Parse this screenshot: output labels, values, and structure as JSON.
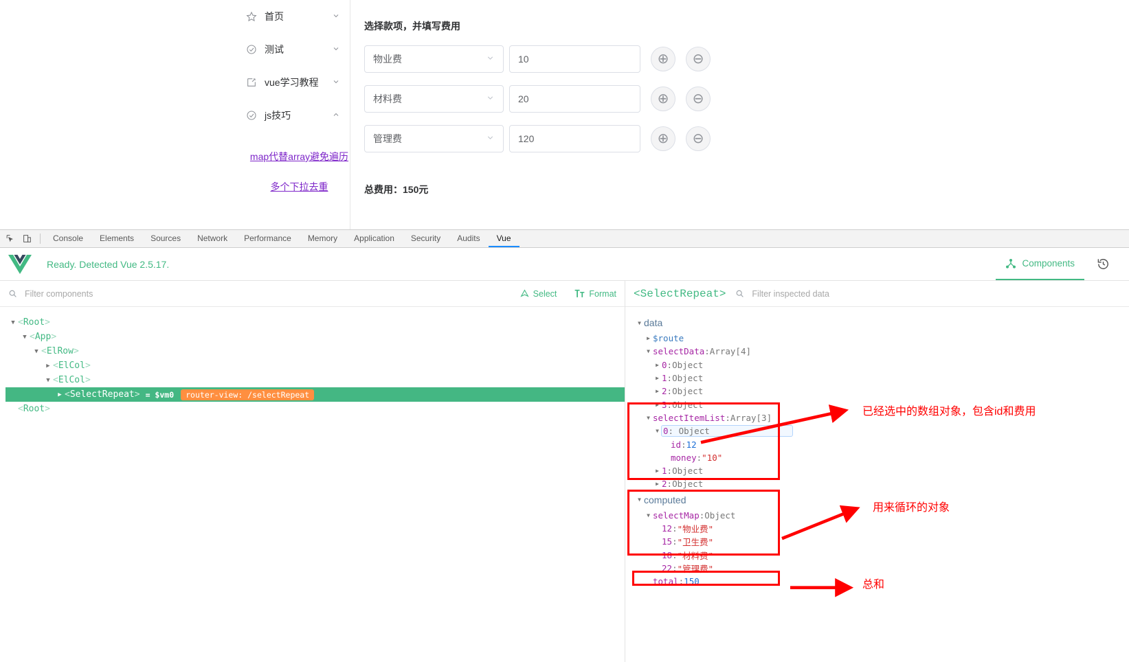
{
  "app": {
    "menu": [
      {
        "label": "首页",
        "icon": "star-icon",
        "arrow": "chevron-down-icon"
      },
      {
        "label": "测试",
        "icon": "check-circle-icon",
        "arrow": "chevron-down-icon"
      },
      {
        "label": "vue学习教程",
        "icon": "edit-square-icon",
        "arrow": "chevron-down-icon"
      },
      {
        "label": "js技巧",
        "icon": "check-circle-icon",
        "arrow": "chevron-up-icon"
      }
    ],
    "sub_links": [
      "map代替array避免遍历",
      "多个下拉去重"
    ],
    "main_title": "选择款项，并填写费用",
    "rows": [
      {
        "select": "物业费",
        "amount": "10",
        "add": "⊕",
        "remove": "⊖"
      },
      {
        "select": "材料费",
        "amount": "20",
        "add": "⊕",
        "remove": "⊖"
      },
      {
        "select": "管理费",
        "amount": "120",
        "add": "⊕",
        "remove": "⊖"
      }
    ],
    "total": "总费用：150元"
  },
  "devtools": {
    "tabs": [
      "Console",
      "Elements",
      "Sources",
      "Network",
      "Performance",
      "Memory",
      "Application",
      "Security",
      "Audits",
      "Vue"
    ],
    "active_tab": "Vue",
    "tool_icons": [
      "inspect-element-icon",
      "toggle-device-toolbar-icon"
    ],
    "accent": "#1a8cff"
  },
  "vue": {
    "ready_text": "Ready. Detected Vue 2.5.17.",
    "brand_color": "#42b983",
    "components_tab": "Components",
    "history_icon": "time-travel-icon",
    "logo_icon": "vue-logo-icon"
  },
  "tree_pane": {
    "filter_placeholder": "Filter components",
    "filter_value": "",
    "select_label": "Select",
    "format_label": "Format",
    "rows": [
      {
        "depth": 0,
        "arrow": "▼",
        "name": "Root"
      },
      {
        "depth": 1,
        "arrow": "▼",
        "name": "App"
      },
      {
        "depth": 2,
        "arrow": "▼",
        "name": "ElRow"
      },
      {
        "depth": 3,
        "arrow": "▶",
        "name": "ElCol"
      },
      {
        "depth": 3,
        "arrow": "▼",
        "name": "ElCol"
      },
      {
        "depth": 4,
        "arrow": "▶",
        "name": "SelectRepeat",
        "vm": "= $vm0",
        "badge": "router-view: /selectRepeat",
        "selected": true
      },
      {
        "depth": 0,
        "arrow": "",
        "name": "Root"
      }
    ]
  },
  "inspector": {
    "title": "<SelectRepeat>",
    "filter_placeholder": "Filter inspected data",
    "filter_value": "",
    "groups": [
      {
        "name": "data",
        "rows": [
          {
            "indent": 1,
            "arrow": "▶",
            "key": "$route",
            "key_color": "blue"
          },
          {
            "indent": 1,
            "arrow": "▼",
            "key": "selectData",
            "sep": ": ",
            "type": "Array[4]"
          },
          {
            "indent": 2,
            "arrow": "▶",
            "key": "0",
            "sep": ": ",
            "type": "Object"
          },
          {
            "indent": 2,
            "arrow": "▶",
            "key": "1",
            "sep": ": ",
            "type": "Object"
          },
          {
            "indent": 2,
            "arrow": "▶",
            "key": "2",
            "sep": ": ",
            "type": "Object"
          },
          {
            "indent": 2,
            "arrow": "▶",
            "key": "3",
            "sep": ": ",
            "type": "Object"
          },
          {
            "indent": 1,
            "arrow": "▼",
            "key": "selectItemList",
            "sep": ": ",
            "type": "Array[3]"
          },
          {
            "indent": 2,
            "arrow": "▼",
            "key": "0",
            "sep": ": ",
            "type": "Object",
            "highlight": true
          },
          {
            "indent": 3,
            "arrow": "",
            "key": "id",
            "sep": ": ",
            "num": "12"
          },
          {
            "indent": 3,
            "arrow": "",
            "key": "money",
            "sep": ": ",
            "str": "\"10\""
          },
          {
            "indent": 2,
            "arrow": "▶",
            "key": "1",
            "sep": ": ",
            "type": "Object"
          },
          {
            "indent": 2,
            "arrow": "▶",
            "key": "2",
            "sep": ": ",
            "type": "Object"
          }
        ]
      },
      {
        "name": "computed",
        "rows": [
          {
            "indent": 1,
            "arrow": "▼",
            "key": "selectMap",
            "sep": ": ",
            "type": "Object"
          },
          {
            "indent": 2,
            "arrow": "",
            "key": "12",
            "sep": ": ",
            "str": "\"物业费\""
          },
          {
            "indent": 2,
            "arrow": "",
            "key": "15",
            "sep": ": ",
            "str": "\"卫生费\""
          },
          {
            "indent": 2,
            "arrow": "",
            "key": "18",
            "sep": ": ",
            "str": "\"材料费\""
          },
          {
            "indent": 2,
            "arrow": "",
            "key": "22",
            "sep": ": ",
            "str": "\"管理费\""
          },
          {
            "indent": 1,
            "arrow": "",
            "key": "total",
            "sep": ": ",
            "num": "150"
          }
        ]
      }
    ]
  },
  "annotations": {
    "color": "#ff0000",
    "notes": [
      {
        "text": "已经选中的数组对象，包含id和费用"
      },
      {
        "text": "用来循环的对象"
      },
      {
        "text": "总和"
      }
    ]
  }
}
